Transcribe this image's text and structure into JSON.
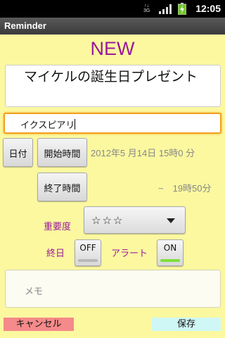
{
  "status_bar": {
    "time": "12:05",
    "network_label": "3G",
    "icons": [
      "signal-icon",
      "battery-charging-icon"
    ]
  },
  "app": {
    "title": "Reminder"
  },
  "form": {
    "heading": "NEW",
    "title_value": "マイケルの誕生日プレゼント",
    "place_value": "イクスピアリ",
    "date_button": "日付",
    "start_time_button": "開始時間",
    "end_time_button": "終了時間",
    "date_text": "2012年5 月14日 15時0 分",
    "end_time_text": "~　19時50分",
    "importance_label": "重要度",
    "importance_value": "☆☆☆",
    "all_day_label": "終日",
    "all_day_toggle": "OFF",
    "alert_label": "アラート",
    "alert_toggle": "ON",
    "memo_placeholder": "メモ",
    "cancel_button": "キャンセル",
    "save_button": "保存"
  },
  "colors": {
    "background": "#fbf8a0",
    "heading": "#9a1a9a",
    "toggle_on": "#7ee03a",
    "cancel": "#f58a8a",
    "save": "#cff7f5",
    "focus_border": "#f0a020"
  }
}
